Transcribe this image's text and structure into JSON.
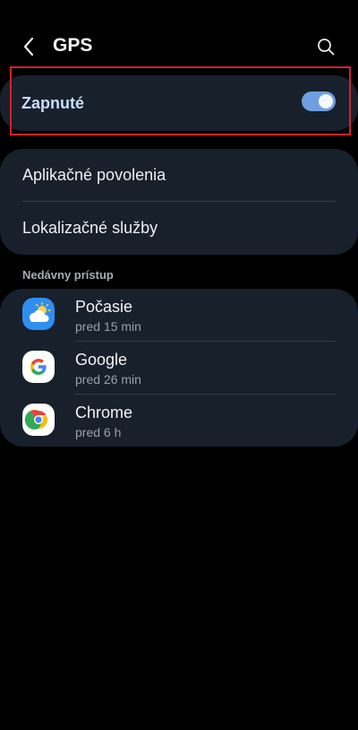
{
  "header": {
    "title": "GPS",
    "back_icon": "back-arrow-icon",
    "search_icon": "search-icon"
  },
  "location_toggle": {
    "label": "Zapnuté",
    "state": "on",
    "accent_color": "#6f9fe0"
  },
  "menu": {
    "items": [
      {
        "label": "Aplikačné povolenia"
      },
      {
        "label": "Lokalizačné služby"
      }
    ]
  },
  "recent_access": {
    "section_title": "Nedávny prístup",
    "apps": [
      {
        "name": "Počasie",
        "time": "pred 15 min",
        "icon": "weather-icon"
      },
      {
        "name": "Google",
        "time": "pred 26 min",
        "icon": "google-icon"
      },
      {
        "name": "Chrome",
        "time": "pred 6 h",
        "icon": "chrome-icon"
      }
    ]
  },
  "colors": {
    "background": "#000000",
    "card": "#17202b",
    "highlight_border": "#d3202a"
  }
}
